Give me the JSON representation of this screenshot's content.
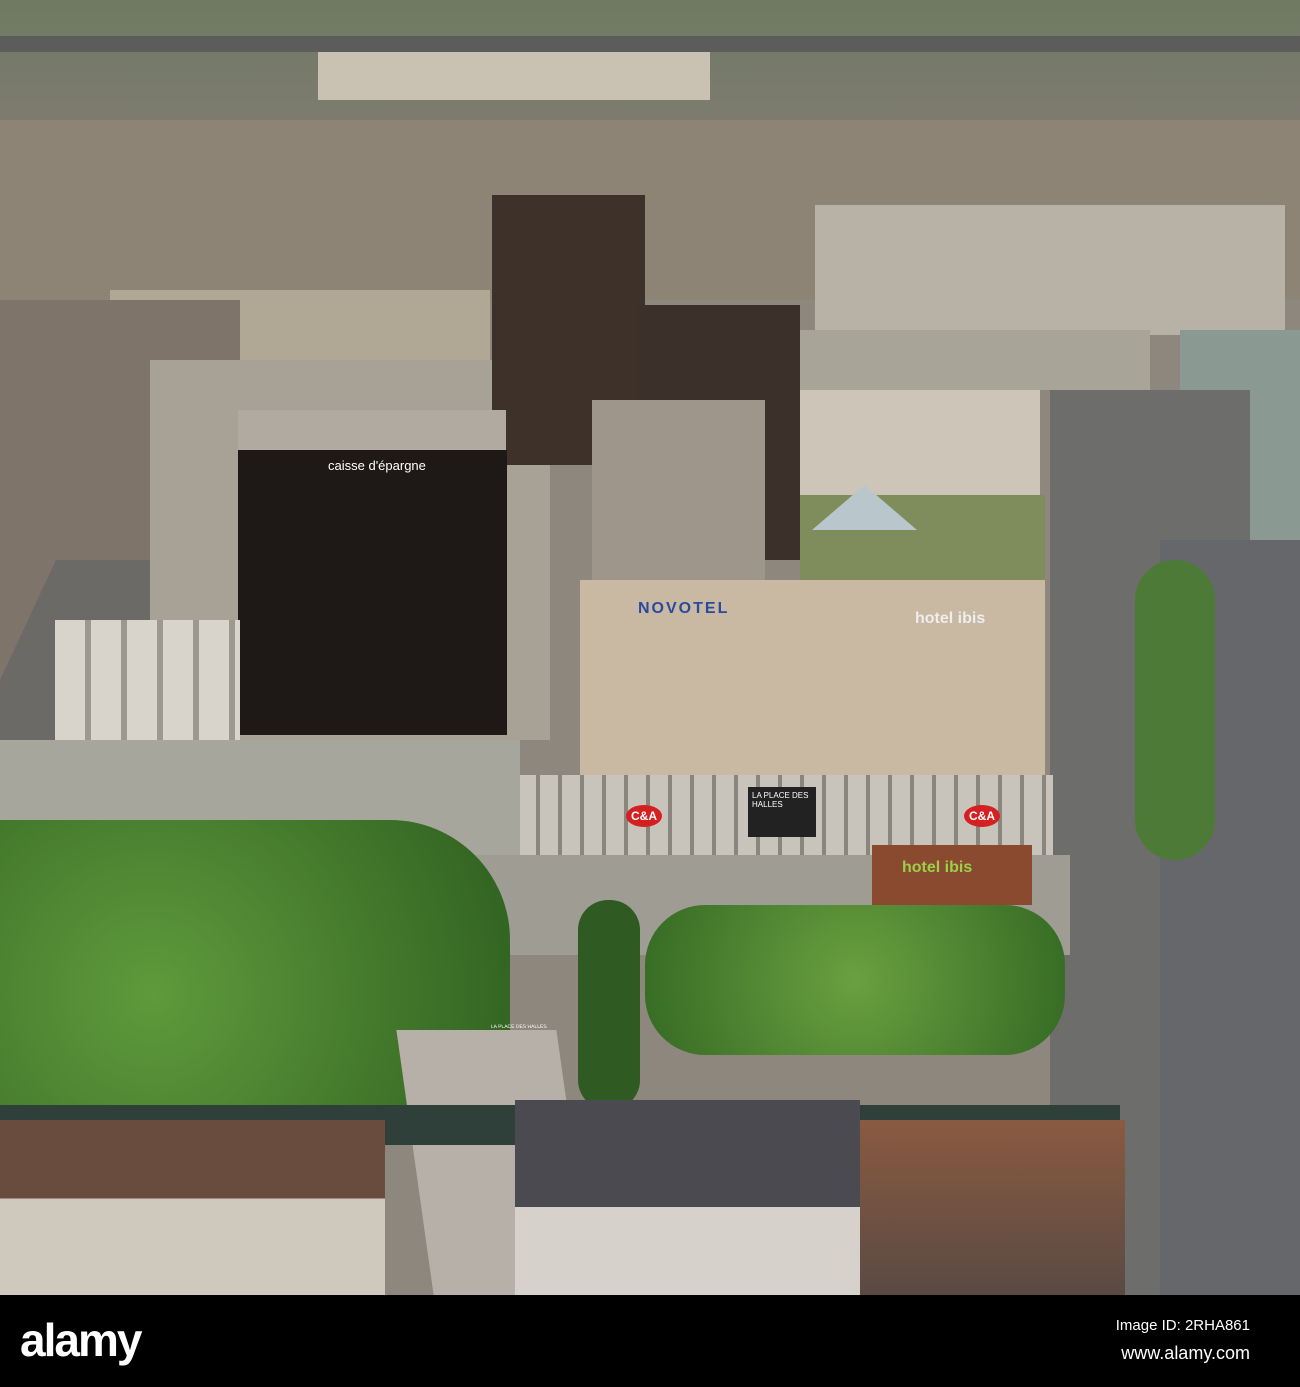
{
  "photo": {
    "signs": {
      "caisse": "caisse d'épargne",
      "novotel": "NOVOTEL",
      "ibis_roof": "hotel ibis",
      "ibis_front": "hotel ibis",
      "ca_left": "C&A",
      "ca_right": "C&A",
      "place_des_halles": "LA PLACE DES HALLES",
      "entrance": "LA PLACE DES HALLES"
    }
  },
  "watermark": {
    "logo": "alamy",
    "image_id": "Image ID: 2RHA861",
    "url": "www.alamy.com"
  }
}
